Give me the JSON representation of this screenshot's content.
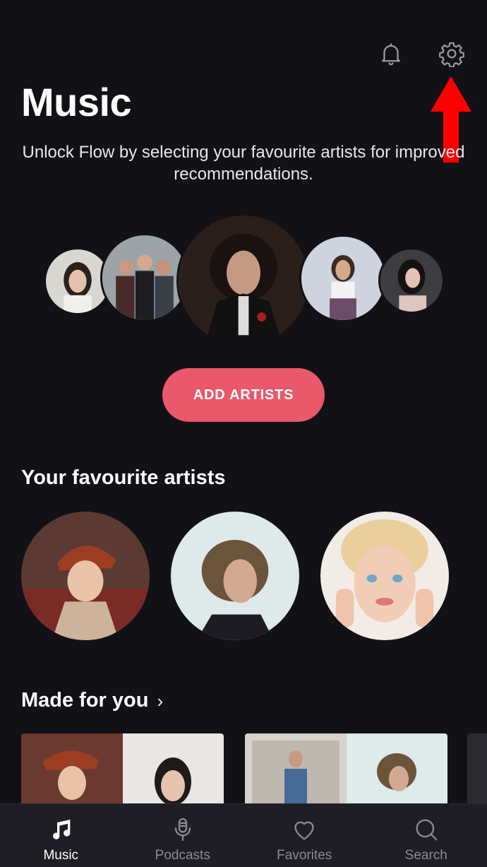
{
  "header": {
    "title": "Music",
    "bell_icon": "bell-icon",
    "settings_icon": "gear-icon"
  },
  "unlock": {
    "message": "Unlock Flow by selecting your favourite artists for improved recommendations."
  },
  "actions": {
    "add_artists_label": "ADD ARTISTS"
  },
  "sections": {
    "favourite_artists_title": "Your favourite artists",
    "made_for_you_title": "Made for you",
    "made_for_you_chevron": "›"
  },
  "tabbar": {
    "items": [
      {
        "label": "Music",
        "icon": "music-note-icon",
        "active": true
      },
      {
        "label": "Podcasts",
        "icon": "microphone-icon",
        "active": false
      },
      {
        "label": "Favorites",
        "icon": "heart-icon",
        "active": false
      },
      {
        "label": "Search",
        "icon": "search-icon",
        "active": false
      }
    ]
  },
  "colors": {
    "background": "#121216",
    "accent": "#e9586b",
    "annotation_arrow": "#ff0000",
    "tabbar": "#1e1e24"
  }
}
